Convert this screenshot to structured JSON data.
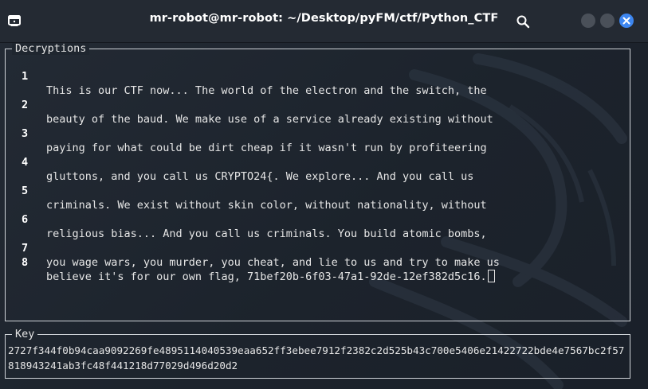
{
  "window": {
    "title": "mr-robot@mr-robot: ~/Desktop/pyFM/ctf/Python_CTF"
  },
  "decryptions": {
    "title": "Decryptions",
    "lines": [
      {
        "num": "1",
        "text": "This is our CTF now... The world of the electron and the switch, the"
      },
      {
        "num": "2",
        "text": "beauty of the baud. We make use of a service already existing without"
      },
      {
        "num": "3",
        "text": "paying for what could be dirt cheap if it wasn't run by profiteering"
      },
      {
        "num": "4",
        "text": "gluttons, and you call us CRYPTO24{. We explore... And you call us"
      },
      {
        "num": "5",
        "text": "criminals. We exist without skin color, without nationality, without"
      },
      {
        "num": "6",
        "text": "religious bias... And you call us criminals. You build atomic bombs,"
      },
      {
        "num": "7",
        "text": "you wage wars, you murder, you cheat, and lie to us and try to make us"
      },
      {
        "num": "8",
        "text": "believe it's for our own flag, 71bef20b-6f03-47a1-92de-12ef382d5c16."
      }
    ]
  },
  "key": {
    "title": "Key",
    "value": "2727f344f0b94caa9092269fe4895114040539eaa652ff3ebee7912f2382c2d525b43c700e5406e21422722bde4e7567bc2f57818943241ab3fc48f441218d77029d496d20d2"
  },
  "colors": {
    "titlebar_bg": "#242a33",
    "terminal_bg": "#1f262f",
    "accent_close": "#3d86f0",
    "text": "#e6e6e6"
  },
  "icons": [
    "terminal-icon",
    "search-icon",
    "minimize-icon",
    "maximize-icon",
    "close-icon"
  ]
}
